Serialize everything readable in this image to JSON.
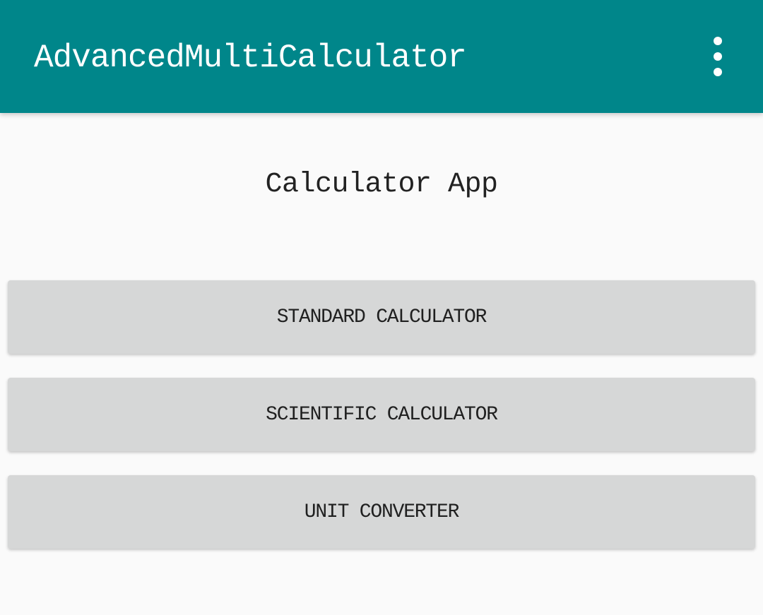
{
  "app_bar": {
    "title": "AdvancedMultiCalculator",
    "menu_icon": "more-vert-icon",
    "background_color": "#00868a"
  },
  "main": {
    "heading": "Calculator App",
    "buttons": [
      {
        "label": "STANDARD CALCULATOR"
      },
      {
        "label": "SCIENTIFIC CALCULATOR"
      },
      {
        "label": "UNIT CONVERTER"
      }
    ],
    "button_color": "#d6d7d7",
    "background_color": "#fafafa"
  }
}
